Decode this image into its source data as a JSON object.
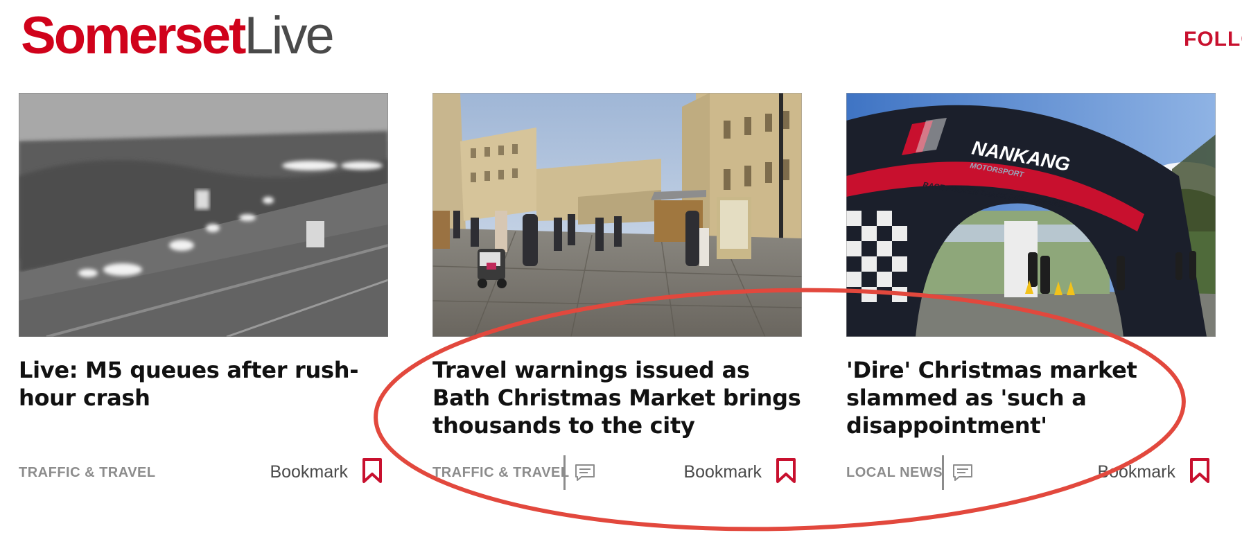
{
  "header": {
    "logo_brand": "Somerset",
    "logo_sub": "Live",
    "follow_label": "FOLLO"
  },
  "cards": [
    {
      "headline": "Live: M5 queues after rush-hour crash",
      "category": "TRAFFIC & TRAVEL",
      "bookmark_label": "Bookmark",
      "has_comments": false,
      "image": "motorway traffic camera still"
    },
    {
      "headline": "Travel warnings issued as Bath Christmas Market brings thousands to the city",
      "category": "TRAFFIC & TRAVEL",
      "bookmark_label": "Bookmark",
      "has_comments": true,
      "image": "Bath Christmas market square with crowd"
    },
    {
      "headline": "'Dire' Christmas market slammed as 'such a disappointment'",
      "category": "LOCAL NEWS",
      "bookmark_label": "Bookmark",
      "has_comments": true,
      "image": "NANKANG motorsport inflatable arch",
      "image_text": "NANKANG",
      "image_text_small": "MOTORSPORT",
      "image_text_banner": "RACE PROVEN TRACK PERFORMANCE"
    }
  ],
  "colors": {
    "brand_red": "#d0021b",
    "headline": "#111111",
    "muted": "#8c8c8c",
    "annotation_ring": "#e2483d"
  },
  "icons": {
    "comment": "comment-icon",
    "bookmark": "bookmark-icon"
  }
}
